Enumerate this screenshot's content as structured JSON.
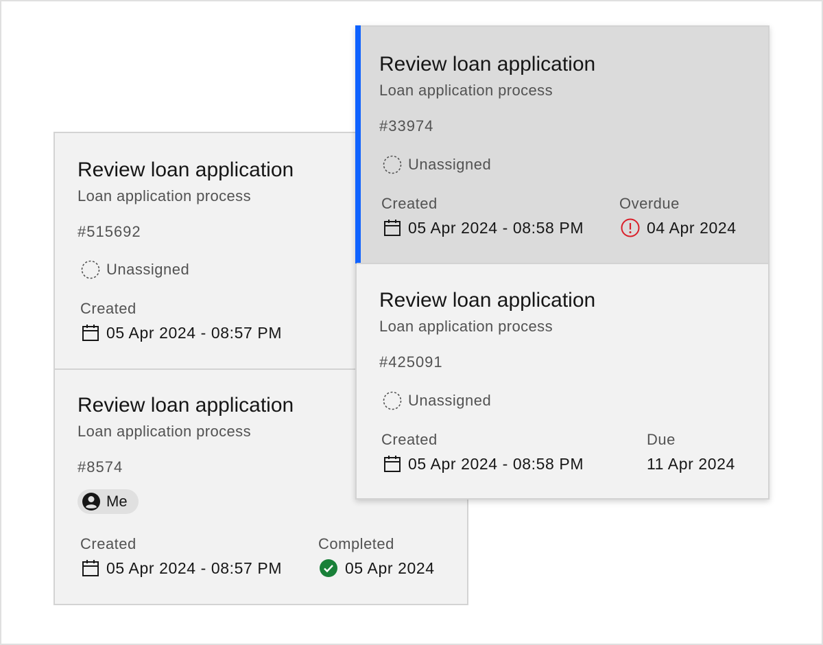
{
  "cards": {
    "c515692": {
      "title": "Review loan application",
      "process": "Loan application process",
      "ticket": "#515692",
      "assignee": "Unassigned",
      "created_label": "Created",
      "created_value": "05 Apr 2024 - 08:57 PM"
    },
    "c8574": {
      "title": "Review loan application",
      "process": "Loan application process",
      "ticket": "#8574",
      "assignee": "Me",
      "created_label": "Created",
      "created_value": "05 Apr 2024 - 08:57 PM",
      "status_label": "Completed",
      "status_value": "05 Apr 2024",
      "status_color": "#198038"
    },
    "c33974": {
      "title": "Review loan application",
      "process": "Loan application process",
      "ticket": "#33974",
      "assignee": "Unassigned",
      "created_label": "Created",
      "created_value": "05 Apr 2024 - 08:58 PM",
      "status_label": "Overdue",
      "status_value": "04 Apr 2024",
      "status_color": "#da1e28",
      "selected": true,
      "accent_color": "#0f62fe"
    },
    "c425091": {
      "title": "Review loan application",
      "process": "Loan application process",
      "ticket": "#425091",
      "assignee": "Unassigned",
      "created_label": "Created",
      "created_value": "05 Apr 2024 - 08:58 PM",
      "status_label": "Due",
      "status_value": "11 Apr 2024"
    }
  },
  "icons": {
    "unassigned": "dashed-circle-icon",
    "me": "user-avatar-icon",
    "created": "calendar-icon",
    "completed": "checkmark-filled-icon",
    "overdue": "warning-circle-icon"
  }
}
